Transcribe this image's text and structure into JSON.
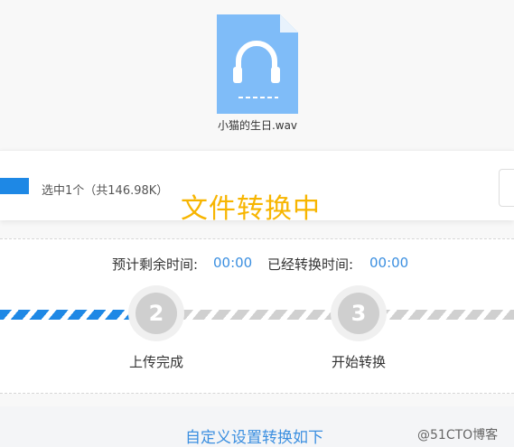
{
  "file": {
    "name": "小猫的生日.wav",
    "icon": "audio-file-icon",
    "icon_color": "#7fbcf8"
  },
  "selection": {
    "summary": "选中1个（共146.98K）"
  },
  "status": {
    "title": "文件转换中",
    "title_color": "#f7b500"
  },
  "times": {
    "remaining_label": "预计剩余时间:",
    "remaining_value": "00:00",
    "elapsed_label": "已经转换时间:",
    "elapsed_value": "00:00"
  },
  "steps": [
    {
      "number": "2",
      "label": "上传完成"
    },
    {
      "number": "3",
      "label": "开始转换"
    }
  ],
  "custom_settings": {
    "link_text": "自定义设置转换如下"
  },
  "watermark": "@51CTO博客",
  "colors": {
    "accent_blue": "#1e88e5",
    "link_blue": "#3b8fe0",
    "inactive_gray": "#cfcfcf"
  }
}
